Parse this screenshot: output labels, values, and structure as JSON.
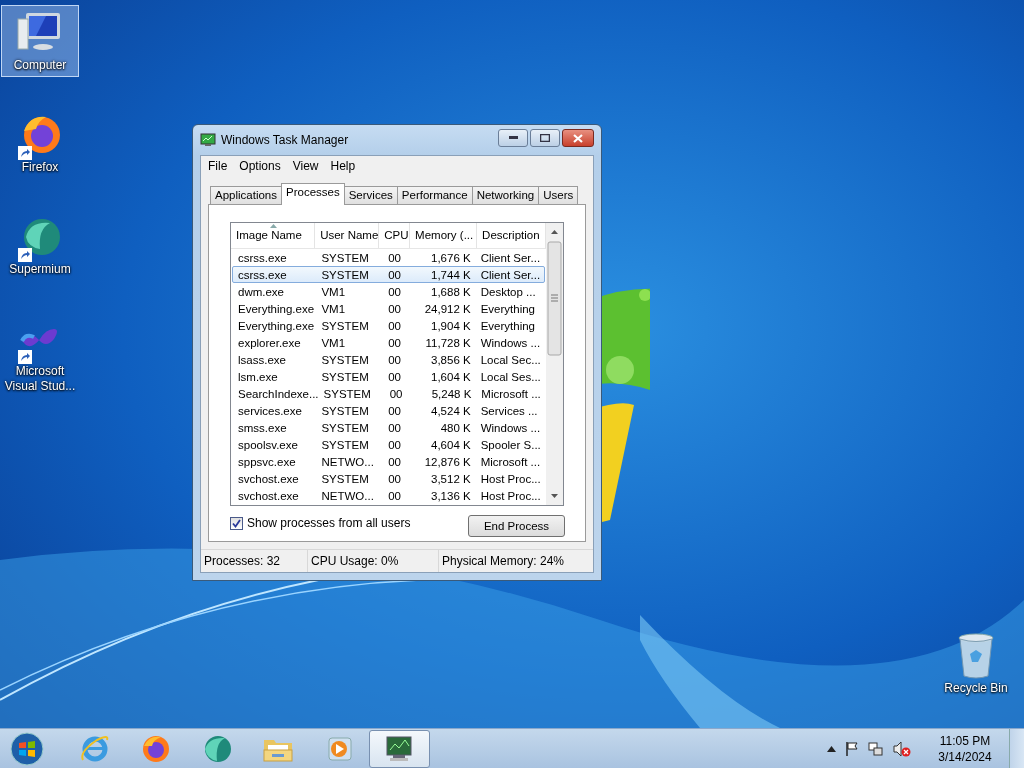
{
  "desktop_icons": [
    {
      "label": "Computer",
      "kind": "computer",
      "selected": true,
      "shortcut": false
    },
    {
      "label": "Firefox",
      "kind": "firefox",
      "selected": false,
      "shortcut": true
    },
    {
      "label": "Supermium",
      "kind": "supermium",
      "selected": false,
      "shortcut": true
    },
    {
      "label": "Microsoft Visual Stud...",
      "kind": "visual-studio",
      "selected": false,
      "shortcut": true
    }
  ],
  "corner_icon": {
    "label": "Recycle Bin",
    "kind": "recycle-bin",
    "selected": false,
    "shortcut": false
  },
  "window": {
    "title": "Windows Task Manager",
    "menu": [
      "File",
      "Options",
      "View",
      "Help"
    ],
    "tabs": [
      {
        "label": "Applications",
        "selected": false
      },
      {
        "label": "Processes",
        "selected": true
      },
      {
        "label": "Services",
        "selected": false
      },
      {
        "label": "Performance",
        "selected": false
      },
      {
        "label": "Networking",
        "selected": false
      },
      {
        "label": "Users",
        "selected": false
      }
    ],
    "table": {
      "columns": [
        {
          "label": "Image Name",
          "sorted": true
        },
        {
          "label": "User Name",
          "sorted": false
        },
        {
          "label": "CPU",
          "sorted": false
        },
        {
          "label": "Memory (...",
          "sorted": false
        },
        {
          "label": "Description",
          "sorted": false
        }
      ],
      "rows": [
        {
          "cells": [
            "csrss.exe",
            "SYSTEM",
            "00",
            "1,676 K",
            "Client Ser..."
          ],
          "selected": false
        },
        {
          "cells": [
            "csrss.exe",
            "SYSTEM",
            "00",
            "1,744 K",
            "Client Ser..."
          ],
          "selected": true
        },
        {
          "cells": [
            "dwm.exe",
            "VM1",
            "00",
            "1,688 K",
            "Desktop ..."
          ],
          "selected": false
        },
        {
          "cells": [
            "Everything.exe",
            "VM1",
            "00",
            "24,912 K",
            "Everything"
          ],
          "selected": false
        },
        {
          "cells": [
            "Everything.exe",
            "SYSTEM",
            "00",
            "1,904 K",
            "Everything"
          ],
          "selected": false
        },
        {
          "cells": [
            "explorer.exe",
            "VM1",
            "00",
            "11,728 K",
            "Windows ..."
          ],
          "selected": false
        },
        {
          "cells": [
            "lsass.exe",
            "SYSTEM",
            "00",
            "3,856 K",
            "Local Sec..."
          ],
          "selected": false
        },
        {
          "cells": [
            "lsm.exe",
            "SYSTEM",
            "00",
            "1,604 K",
            "Local Ses..."
          ],
          "selected": false
        },
        {
          "cells": [
            "SearchIndexe...",
            "SYSTEM",
            "00",
            "5,248 K",
            "Microsoft ..."
          ],
          "selected": false
        },
        {
          "cells": [
            "services.exe",
            "SYSTEM",
            "00",
            "4,524 K",
            "Services ..."
          ],
          "selected": false
        },
        {
          "cells": [
            "smss.exe",
            "SYSTEM",
            "00",
            "480 K",
            "Windows ..."
          ],
          "selected": false
        },
        {
          "cells": [
            "spoolsv.exe",
            "SYSTEM",
            "00",
            "4,604 K",
            "Spooler S..."
          ],
          "selected": false
        },
        {
          "cells": [
            "sppsvc.exe",
            "NETWO...",
            "00",
            "12,876 K",
            "Microsoft ..."
          ],
          "selected": false
        },
        {
          "cells": [
            "svchost.exe",
            "SYSTEM",
            "00",
            "3,512 K",
            "Host Proc..."
          ],
          "selected": false
        },
        {
          "cells": [
            "svchost.exe",
            "NETWO...",
            "00",
            "3,136 K",
            "Host Proc..."
          ],
          "selected": false
        }
      ]
    },
    "show_all": {
      "label": "Show processes from all users",
      "checked": true
    },
    "end_button": "End Process",
    "status_bar": [
      "Processes: 32",
      "CPU Usage: 0%",
      "Physical Memory: 24%"
    ]
  },
  "taskbar": {
    "items": [
      {
        "kind": "ie",
        "active": false
      },
      {
        "kind": "firefox",
        "active": false
      },
      {
        "kind": "supermium",
        "active": false
      },
      {
        "kind": "explorer",
        "active": false
      },
      {
        "kind": "media-player",
        "active": false
      },
      {
        "kind": "task-manager",
        "active": true
      }
    ],
    "time": "11:05 PM",
    "date": "3/14/2024"
  }
}
